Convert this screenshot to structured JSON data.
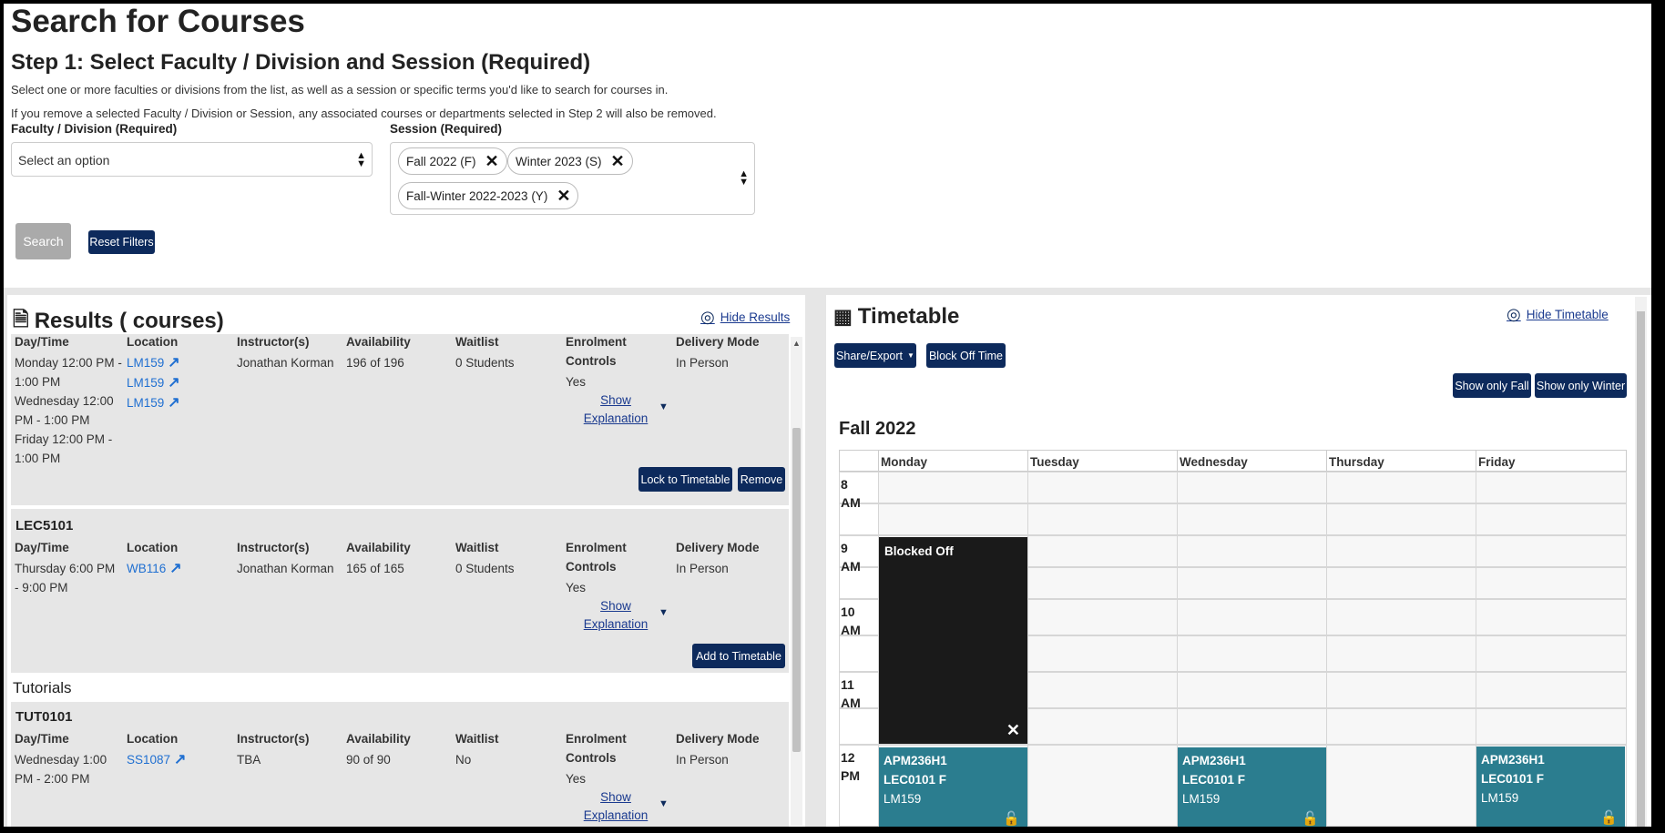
{
  "search": {
    "page_title": "Search for Courses",
    "step_title": "Step 1: Select Faculty / Division and Session (Required)",
    "step_desc_1": "Select one or more faculties or divisions from the list, as well as a session or specific terms you'd like to search for courses in.",
    "step_desc_2": "If you remove a selected Faculty / Division or Session, any associated courses or departments selected in Step 2 will also be removed.",
    "faculty_label": "Faculty / Division (Required)",
    "faculty_placeholder": "Select an option",
    "session_label": "Session (Required)",
    "session_chips": [
      "Fall 2022 (F)",
      "Winter 2023  (S)",
      "Fall-Winter 2022-2023 (Y)"
    ],
    "search_label": "Search",
    "reset_label": "Reset Filters"
  },
  "results": {
    "title": "Results ( courses)",
    "hide_label": "Hide Results",
    "columns": [
      "Day/Time",
      "Location",
      "Instructor(s)",
      "Availability",
      "Waitlist",
      "Enrolment Controls",
      "Delivery Mode"
    ],
    "show_explanation": "Show Explanation",
    "tutorials_label": "Tutorials",
    "sections": [
      {
        "name": "",
        "day_time": "Monday 12:00 PM - 1:00 PM Wednesday 12:00 PM - 1:00 PM Friday 12:00 PM - 1:00 PM",
        "locations": [
          "LM159",
          "LM159",
          "LM159"
        ],
        "instructor": "Jonathan Korman",
        "availability": "196 of 196",
        "waitlist": "0 Students",
        "enrolment": "Yes",
        "delivery": "In Person",
        "buttons": [
          "Lock to Timetable",
          "Remove"
        ]
      },
      {
        "name": "LEC5101",
        "day_time": "Thursday 6:00 PM - 9:00 PM",
        "locations": [
          "WB116"
        ],
        "instructor": "Jonathan Korman",
        "availability": "165 of 165",
        "waitlist": "0 Students",
        "enrolment": "Yes",
        "delivery": "In Person",
        "buttons": [
          "Add to Timetable"
        ]
      },
      {
        "name": "TUT0101",
        "day_time": "Wednesday 1:00 PM - 2:00 PM",
        "locations": [
          "SS1087"
        ],
        "instructor": "TBA",
        "availability": "90 of 90",
        "waitlist": "No",
        "enrolment": "Yes",
        "delivery": "In Person",
        "buttons": []
      }
    ]
  },
  "timetable": {
    "title": "Timetable",
    "hide_label": "Hide Timetable",
    "share_label": "Share/Export",
    "block_label": "Block Off Time",
    "show_fall": "Show only Fall",
    "show_winter": "Show only Winter",
    "term_title": "Fall 2022",
    "days": [
      "Monday",
      "Tuesday",
      "Wednesday",
      "Thursday",
      "Friday"
    ],
    "hours": [
      "8 AM",
      "9 AM",
      "10 AM",
      "11 AM",
      "12 PM"
    ],
    "blocked_label": "Blocked Off",
    "events": [
      {
        "course": "APM236H1",
        "section": "LEC0101 F",
        "room": "LM159"
      },
      {
        "course": "APM236H1",
        "section": "LEC0101 F",
        "room": "LM159"
      },
      {
        "course": "APM236H1",
        "section": "LEC0101 F",
        "room": "LM159"
      }
    ]
  }
}
